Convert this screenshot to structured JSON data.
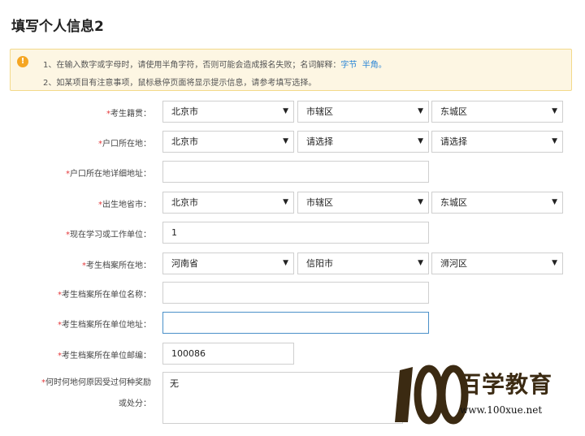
{
  "page": {
    "title": "填写个人信息2"
  },
  "notice": {
    "icon": "warning-icon",
    "line1_prefix": "1、在输入数字或字母时，请使用半角字符，否则可能会造成报名失败；名词解释：",
    "line1_link1": "字节",
    "line1_link2": "半角。",
    "line2": "2、如某项目有注意事项，鼠标悬停页面将显示提示信息，请参考填写选择。"
  },
  "form": {
    "required_mark": "*",
    "native_place": {
      "label": "考生籍贯：",
      "province": "北京市",
      "city": "市辖区",
      "district": "东城区"
    },
    "hukou": {
      "label": "户口所在地：",
      "province": "北京市",
      "city": "请选择",
      "district": "请选择"
    },
    "hukou_address": {
      "label": "户口所在地详细地址：",
      "value": ""
    },
    "birthplace": {
      "label": "出生地省市：",
      "province": "北京市",
      "city": "市辖区",
      "district": "东城区"
    },
    "work_unit": {
      "label": "现在学习或工作单位：",
      "value": "1"
    },
    "archive_location": {
      "label": "考生档案所在地：",
      "province": "河南省",
      "city": "信阳市",
      "district": "浉河区"
    },
    "archive_unit_name": {
      "label": "考生档案所在单位名称：",
      "value": ""
    },
    "archive_unit_address": {
      "label": "考生档案所在单位地址：",
      "value": ""
    },
    "archive_unit_postcode": {
      "label": "考生档案所在单位邮编：",
      "value": "100086"
    },
    "awards": {
      "label_line1": "何时何地何原因受过何种奖励",
      "label_line2": "或处分：",
      "value": "无"
    }
  },
  "watermark": {
    "number": "100",
    "name": "百学教育",
    "url": "www.100xue.net"
  },
  "colors": {
    "required": "#e4393c",
    "link": "#2a86d6",
    "notice_bg": "#fdf6e3",
    "focus_border": "#4a90c8"
  }
}
